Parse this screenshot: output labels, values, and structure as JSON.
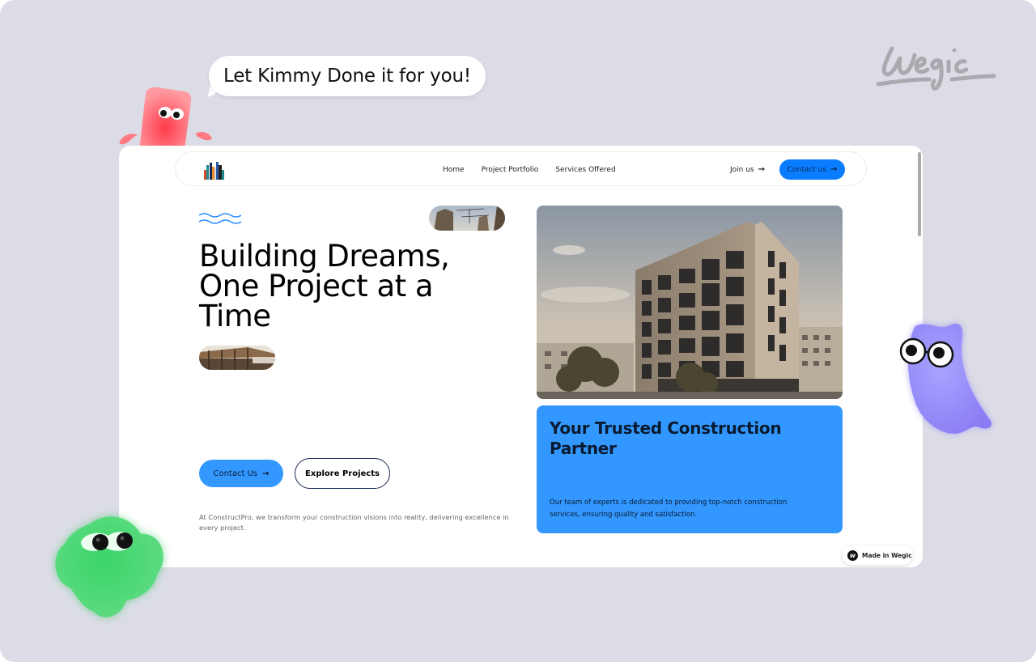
{
  "overlay": {
    "brand_name": "Wegic",
    "bubble_text": "Let Kimmy Done it for you!",
    "made_in_badge": "Made in Wegic",
    "made_icon_glyph": "w"
  },
  "site": {
    "nav": {
      "links": [
        {
          "label": "Home"
        },
        {
          "label": "Project Portfolio"
        },
        {
          "label": "Services Offered"
        }
      ],
      "join_label": "Join us",
      "contact_label": "Contact us",
      "arrow_glyph": "→"
    },
    "hero": {
      "title": "Building Dreams, One Project at a Time",
      "primary_button": "Contact Us",
      "secondary_button": "Explore Projects",
      "description": "At ConstructPro, we transform your construction visions into reality, delivering excellence in every project."
    },
    "card": {
      "title": "Your Trusted Construction Partner",
      "description": "Our team of experts is dedicated to providing top-notch construction services, ensuring quality and satisfaction."
    }
  },
  "colors": {
    "accent": "#3298ff",
    "nav_accent": "#0a7cff",
    "background": "#dcdce6"
  }
}
